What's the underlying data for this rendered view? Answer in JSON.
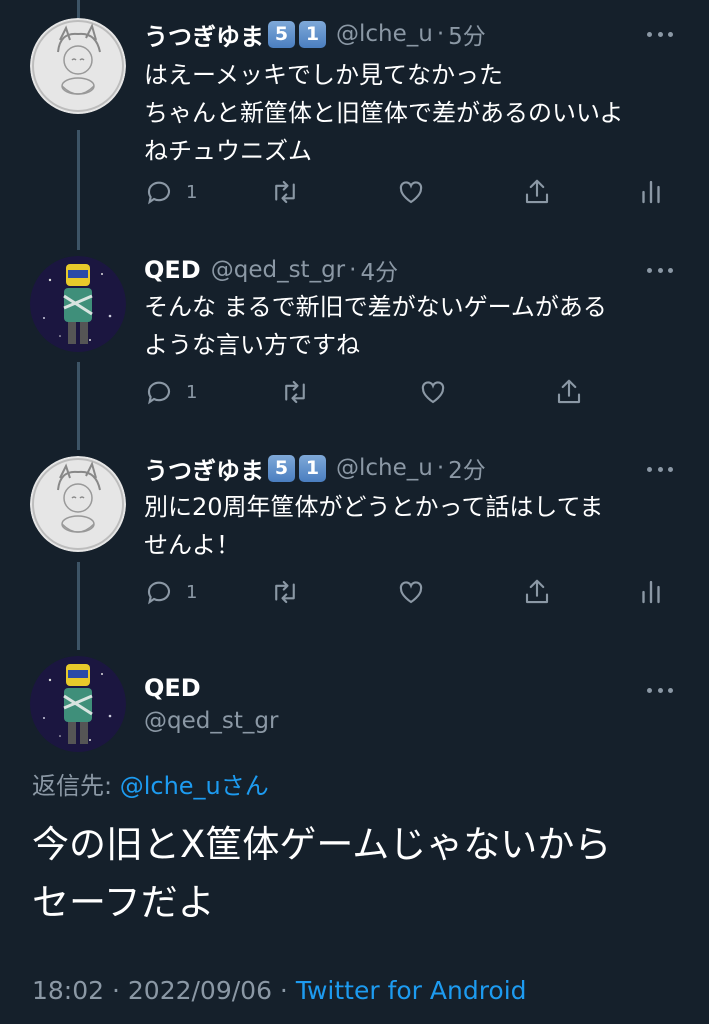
{
  "tweets": [
    {
      "display_name": "うつぎゆま",
      "badges": [
        "5",
        "1"
      ],
      "handle": "@lche_u",
      "time": "5分",
      "text": "はえーメッキでしか見てなかった\nちゃんと新筐体と旧筐体で差があるのいいよ\nねチュウニズム",
      "reply_count": "1"
    },
    {
      "display_name": "QED",
      "handle": "@qed_st_gr",
      "time": "4分",
      "text": "そんな まるで新旧で差がないゲームがある\nような言い方ですね",
      "reply_count": "1"
    },
    {
      "display_name": "うつぎゆま",
      "badges": [
        "5",
        "1"
      ],
      "handle": "@lche_u",
      "time": "2分",
      "text": "別に20周年筐体がどうとかって話はしてま\nせんよ！",
      "reply_count": "1"
    }
  ],
  "main_tweet": {
    "display_name": "QED",
    "handle": "@qed_st_gr",
    "reply_prefix": "返信先: ",
    "reply_mention": "@lche_u",
    "reply_suffix": "さん",
    "text": "今の旧とX筐体ゲームじゃないから\nセーフだよ",
    "timestamp": "18:02 · 2022/09/06 · ",
    "source": "Twitter for Android"
  },
  "separator": "·",
  "icons": [
    "reply-icon",
    "retweet-icon",
    "like-icon",
    "share-icon",
    "analytics-icon",
    "more-icon"
  ],
  "colors": {
    "background": "#15202b",
    "secondary_text": "#8b98a5",
    "link": "#1d9bf0"
  }
}
